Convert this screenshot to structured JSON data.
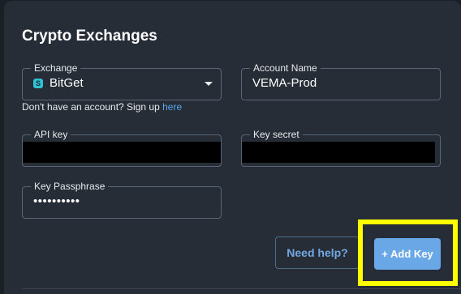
{
  "panel": {
    "title": "Crypto Exchanges"
  },
  "exchange": {
    "label": "Exchange",
    "selected": "BitGet",
    "icon": "bitget-logo-icon"
  },
  "account_name": {
    "label": "Account Name",
    "value": "VEMA-Prod"
  },
  "signup": {
    "text": "Don't have an account? Sign up ",
    "link": "here"
  },
  "api_key": {
    "label": "API key"
  },
  "key_secret": {
    "label": "Key secret"
  },
  "passphrase": {
    "label": "Key Passphrase",
    "value": "••••••••••"
  },
  "buttons": {
    "help": "Need help?",
    "add_key": "+ Add Key"
  },
  "colors": {
    "accent": "#6aa7e6",
    "highlight": "#ffff00",
    "link": "#5aa7ef"
  }
}
